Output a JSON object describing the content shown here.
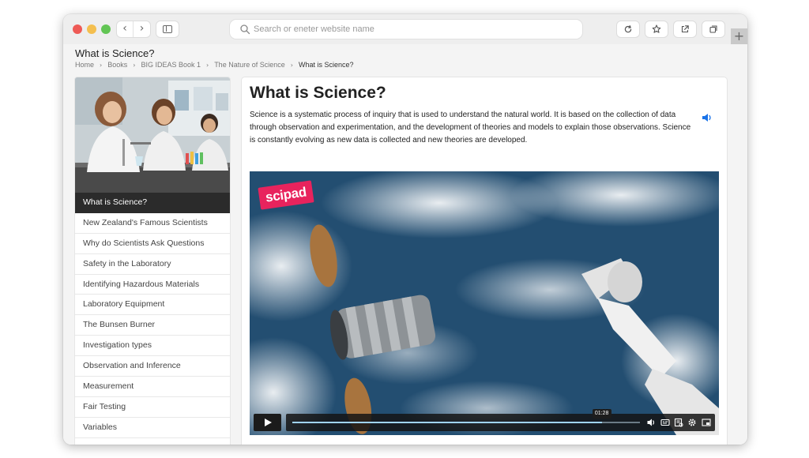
{
  "browser": {
    "search": {
      "placeholder": "Search or eneter website name"
    },
    "icons": {
      "back": "chevron-left-icon",
      "forward": "chevron-right-icon",
      "sidebar": "sidebar-icon",
      "reload": "reload-icon",
      "bookmark": "star-icon",
      "share": "share-icon",
      "tabs": "tabs-icon",
      "new_tab": "plus-icon"
    },
    "new_tab_label": "+",
    "back_glyph": "‹",
    "forward_glyph": "›"
  },
  "page": {
    "heading": "What is Science?",
    "breadcrumb": [
      {
        "label": "Home"
      },
      {
        "label": "Books"
      },
      {
        "label": "BIG IDEAS Book 1"
      },
      {
        "label": "The Nature of Science"
      },
      {
        "label": "What is Science?"
      }
    ],
    "breadcrumb_separator": "›"
  },
  "sidebar": {
    "image": "students-laboratory-photo",
    "items": [
      {
        "label": "What is Science?",
        "active": true
      },
      {
        "label": "New Zealand's Famous Scientists"
      },
      {
        "label": "Why do Scientists Ask Questions"
      },
      {
        "label": "Safety in the Laboratory"
      },
      {
        "label": "Identifying Hazardous Materials"
      },
      {
        "label": "Laboratory Equipment"
      },
      {
        "label": "The Bunsen Burner"
      },
      {
        "label": "Investigation types"
      },
      {
        "label": "Observation and Inference"
      },
      {
        "label": "Measurement"
      },
      {
        "label": "Fair Testing"
      },
      {
        "label": "Variables"
      }
    ]
  },
  "main": {
    "title": "What is Science?",
    "body": "Science is a systematic process of inquiry that is used to understand the natural world. It is based on the collection of data through observation and experimentation, and the development of theories and models to explain those observations. Science is constantly evolving as new data is collected and new theories are developed.",
    "audio_icon": "speaker-icon",
    "video": {
      "logo": "scipad",
      "time_tooltip": "01:28",
      "progress": 0.89,
      "controls": [
        "volume-icon",
        "captions-icon",
        "transcript-icon",
        "settings-icon",
        "picture-in-picture-icon"
      ]
    }
  },
  "colors": {
    "accent": "#e8235d",
    "active_menu": "#2b2b2b",
    "progress": "#9fd3ff",
    "audio_icon": "#1a73e8"
  }
}
